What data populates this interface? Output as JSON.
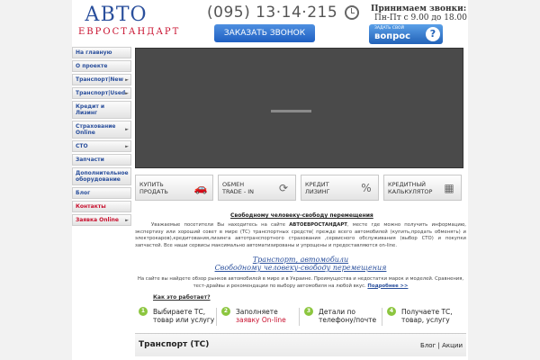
{
  "header": {
    "logo_main": "АВТО",
    "logo_sub": "ЕВРОСТАНДАРТ",
    "phone": "(095) 13·14·215",
    "call_button": "ЗАКАЗАТЬ ЗВОНОК",
    "hours_title": "Принимаем звонки:",
    "hours_value": "Пн-Пт с 9.00 до 18.00",
    "ask_small": "ЗАДАТЬ СВОЙ",
    "ask_big": "вопрос",
    "ask_mark": "?"
  },
  "menu": [
    {
      "label": "На главную",
      "arrow": ""
    },
    {
      "label": "О проекте",
      "arrow": ""
    },
    {
      "label": "Транспорт|New",
      "arrow": "►"
    },
    {
      "label": "Транспорт|Used",
      "arrow": "►"
    },
    {
      "label": "Кредит и Лизинг",
      "arrow": ""
    },
    {
      "label": "Страхование Online",
      "arrow": "►"
    },
    {
      "label": "СТО",
      "arrow": "►"
    },
    {
      "label": "Запчасти",
      "arrow": ""
    },
    {
      "label": "Дополнительное оборудование",
      "arrow": ""
    },
    {
      "label": "Блог",
      "arrow": ""
    },
    {
      "label": "Контакты",
      "arrow": ""
    },
    {
      "label": "Заявка Online",
      "arrow": "►"
    }
  ],
  "tiles": [
    {
      "line1": "КУПИТЬ",
      "line2": "ПРОДАТЬ",
      "icon": "car-icon",
      "glyph": "🚗"
    },
    {
      "line1": "ОБМЕН",
      "line2": "TRADE - IN",
      "icon": "exchange-icon",
      "glyph": "⟳"
    },
    {
      "line1": "КРЕДИТ",
      "line2": "ЛИЗИНГ",
      "icon": "percent-icon",
      "glyph": "%"
    },
    {
      "line1": "КРЕДИТНЫЙ",
      "line2": "КАЛЬКУЛЯТОР",
      "icon": "calculator-icon",
      "glyph": "▦"
    }
  ],
  "content": {
    "heading": "Свободному человеку-свободу перемещения",
    "para1_pre": "Уважаемые посетители Вы находитесь на сайте ",
    "para1_brand": "АВТОЕВРОСТАНДАРТ",
    "para1_post": ", месте где можно получить информацию, экспертизу или хороший совет в мире (ТС) транспортных средств( прежде всего автомобилей (купить,продать обменять) и электрокаров),кредитования,лизинга автотранспортного страхования ,сервисного обслуживания (выбор СТО) и покупки запчастей. Все наши сервисы максимально автоматизированы и упрощены и предоставляются on-line.",
    "link1": "Транспорт, автомобили",
    "link2": "Свободному человеку-свободу перемещения",
    "para2": "На сайте вы найдете обзор рынков автомобилей в мире и в Украине. Преимущества и недостатки марок и моделей. Сравнения, тест-драйвы и рекомендации по выбору автомобиля на любой вкус.",
    "more": "Подробнее >>",
    "how": "Как это работает?"
  },
  "steps": [
    {
      "num": "1",
      "line1": "Выбираете ТС,",
      "line2": "товар или услугу",
      "red": ""
    },
    {
      "num": "2",
      "line1": "Заполняете",
      "line2": "",
      "red": "заявку On-line"
    },
    {
      "num": "3",
      "line1": "Детали по",
      "line2": "телефону/почте",
      "red": ""
    },
    {
      "num": "4",
      "line1": "Получаете ТС,",
      "line2": "товар, услугу",
      "red": ""
    }
  ],
  "section": {
    "title": "Транспорт (ТС)",
    "link_blog": "Блог",
    "sep": "|",
    "link_actions": "Акции"
  },
  "colors": {
    "brand_blue": "#2a4f9c",
    "brand_red": "#c8102e",
    "step_green": "#8cc63f"
  }
}
